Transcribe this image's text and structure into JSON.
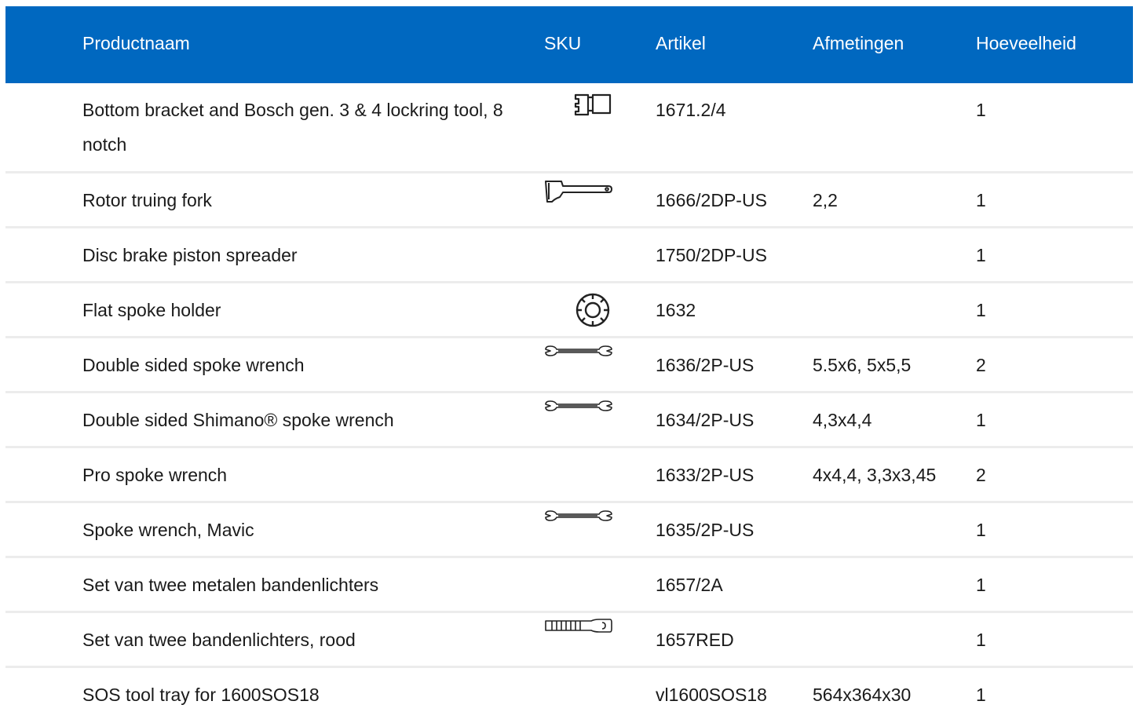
{
  "table": {
    "headers": [
      "Productnaam",
      "SKU",
      "Artikel",
      "Afmetingen",
      "Hoeveelheid"
    ],
    "rows": [
      {
        "name": "Bottom bracket and Bosch gen. 3 & 4 lockring tool, 8 notch",
        "icon": "lockring-tool-icon",
        "article": "1671.2/4",
        "dimensions": "",
        "qty": "1"
      },
      {
        "name": "Rotor truing fork",
        "icon": "rotor-truing-fork-icon",
        "article": "1666/2DP-US",
        "dimensions": "2,2",
        "qty": "1"
      },
      {
        "name": "Disc brake piston spreader",
        "icon": "",
        "article": "1750/2DP-US",
        "dimensions": "",
        "qty": "1"
      },
      {
        "name": "Flat spoke holder",
        "icon": "spoke-holder-icon",
        "article": "1632",
        "dimensions": "",
        "qty": "1"
      },
      {
        "name": "Double sided spoke wrench",
        "icon": "spoke-wrench-icon",
        "article": "1636/2P-US",
        "dimensions": "5.5x6, 5x5,5",
        "qty": "2"
      },
      {
        "name": "Double sided Shimano® spoke wrench",
        "icon": "spoke-wrench-icon",
        "article": "1634/2P-US",
        "dimensions": "4,3x4,4",
        "qty": "1"
      },
      {
        "name": "Pro spoke wrench",
        "icon": "",
        "article": "1633/2P-US",
        "dimensions": "4x4,4, 3,3x3,45",
        "qty": "2"
      },
      {
        "name": "Spoke wrench, Mavic",
        "icon": "spoke-wrench-icon",
        "article": "1635/2P-US",
        "dimensions": "",
        "qty": "1"
      },
      {
        "name": "Set van twee metalen bandenlichters",
        "icon": "",
        "article": "1657/2A",
        "dimensions": "",
        "qty": "1"
      },
      {
        "name": "Set van twee bandenlichters, rood",
        "icon": "tire-lever-icon",
        "article": "1657RED",
        "dimensions": "",
        "qty": "1"
      },
      {
        "name": "SOS tool tray for 1600SOS18",
        "icon": "",
        "article": "vl1600SOS18",
        "dimensions": "564x364x30",
        "qty": "1"
      }
    ]
  },
  "colors": {
    "header_bg": "#0068c0",
    "header_text": "#ffffff",
    "row_divider": "#ececec",
    "body_text": "#1a1a1a"
  }
}
